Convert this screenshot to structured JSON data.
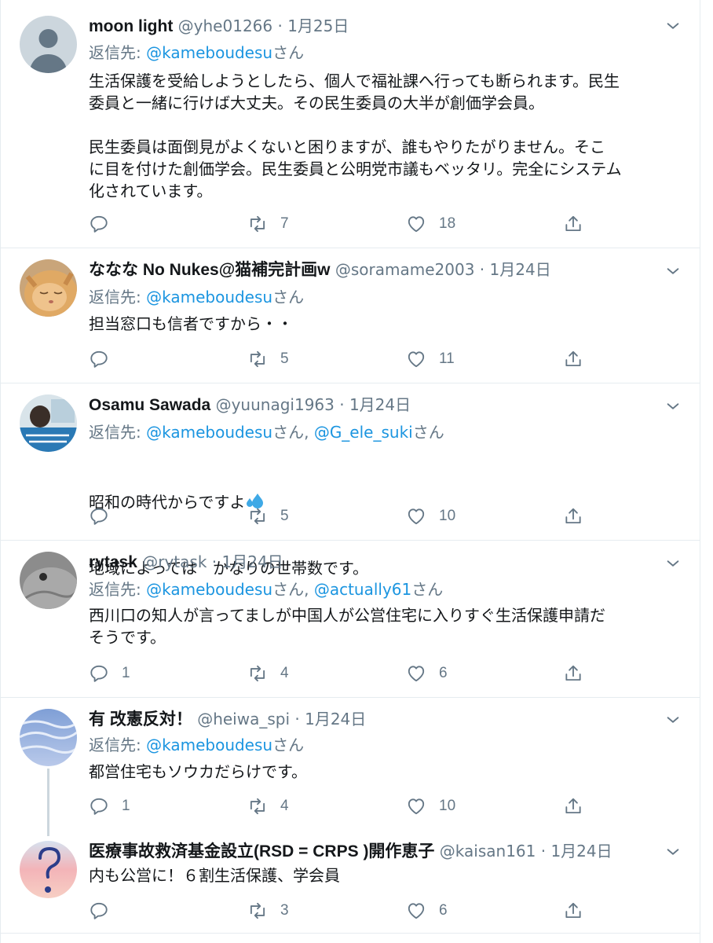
{
  "reply_prefix": "返信先: ",
  "san": "さん",
  "comma": ", ",
  "dot": " · ",
  "tweets": [
    {
      "name": "moon light",
      "handle": "@yhe01266",
      "date": "1月25日",
      "mentions": [
        "@kameboudesu"
      ],
      "text": "生活保護を受給しようとしたら、個人で福祉課へ行っても断られます。民生\n委員と一緒に行けば大丈夫。その民生委員の大半が創価学会員。\n\n民生委員は面倒見がよくないと困りますが、誰もやりたがりません。そこ\nに目を付けた創価学会。民生委員と公明党市議もベッタリ。完全にシステム\n化されています。",
      "replies": "",
      "retweets": "7",
      "likes": "18"
    },
    {
      "name": "ななな No Nukes@猫補完計画w",
      "handle": "@soramame2003",
      "date": "1月24日",
      "mentions": [
        "@kameboudesu"
      ],
      "text": "担当窓口も信者ですから・・",
      "replies": "",
      "retweets": "5",
      "likes": "11"
    },
    {
      "name": "Osamu Sawada",
      "handle": "@yuunagi1963",
      "date": "1月24日",
      "mentions": [
        "@kameboudesu",
        "@G_ele_suki"
      ],
      "text_line1": "昭和の時代からですよ",
      "text_line2": "地域によっては　かなりの世帯数です。",
      "replies": "",
      "retweets": "5",
      "likes": "10"
    },
    {
      "name": "rytask",
      "handle": "@rytask",
      "date": "1月24日",
      "mentions": [
        "@kameboudesu",
        "@actually61"
      ],
      "text": "西川口の知人が言ってましが中国人が公営住宅に入りすぐ生活保護申請だ\nそうです。",
      "replies": "1",
      "retweets": "4",
      "likes": "6"
    },
    {
      "name": "有 改憲反対！",
      "handle": "@heiwa_spi",
      "date": "1月24日",
      "mentions": [
        "@kameboudesu"
      ],
      "text": "都営住宅もソウカだらけです。",
      "replies": "1",
      "retweets": "4",
      "likes": "10"
    },
    {
      "name": "医療事故救済基金設立(RSD = CRPS )開作恵子",
      "handle": "@kaisan161",
      "date": "1月24日",
      "mentions": [],
      "text": "内も公営に！６割生活保護、学会員",
      "replies": "",
      "retweets": "3",
      "likes": "6"
    }
  ],
  "colors": {
    "link": "#1b95e0",
    "muted": "#657786",
    "text": "#14171a",
    "border": "#e6ecf0"
  },
  "icons": [
    "reply-icon",
    "retweet-icon",
    "like-icon",
    "share-icon",
    "chevron-down-icon",
    "sweat-droplets-emoji"
  ]
}
